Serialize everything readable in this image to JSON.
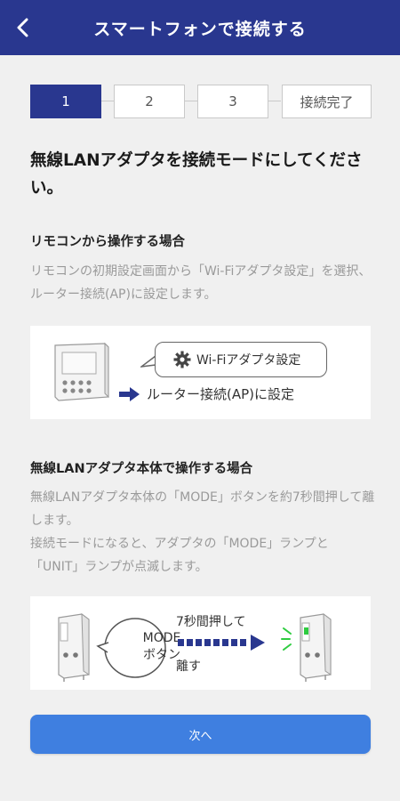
{
  "header": {
    "title": "スマートフォンで接続する"
  },
  "steps": [
    {
      "label": "1"
    },
    {
      "label": "2"
    },
    {
      "label": "3"
    },
    {
      "label": "接続完了"
    }
  ],
  "main_title": "無線LANアダプタを接続モードにしてください。",
  "section_remote": {
    "title": "リモコンから操作する場合",
    "body": "リモコンの初期設定画面から「Wi-Fiアダプタ設定」を選択、ルーター接続(AP)に設定します。",
    "bubble_label": "Wi-Fiアダプタ設定",
    "arrow_label": "ルーター接続(AP)に設定"
  },
  "section_adapter": {
    "title": "無線LANアダプタ本体で操作する場合",
    "body_line1": "無線LANアダプタ本体の「MODE」ボタンを約7秒間押して離します。",
    "body_line2": "接続モードになると、アダプタの「MODE」ランプと「UNIT」ランプが点滅します。",
    "mode_line1": "MODE",
    "mode_line2": "ボタン",
    "press_label": "7秒間押して",
    "release_label": "離す"
  },
  "next_button": "次へ",
  "colors": {
    "header": "#29378f",
    "active_step": "#29378f",
    "button": "#3f7fe0",
    "lamp_green": "#2ecc40"
  }
}
